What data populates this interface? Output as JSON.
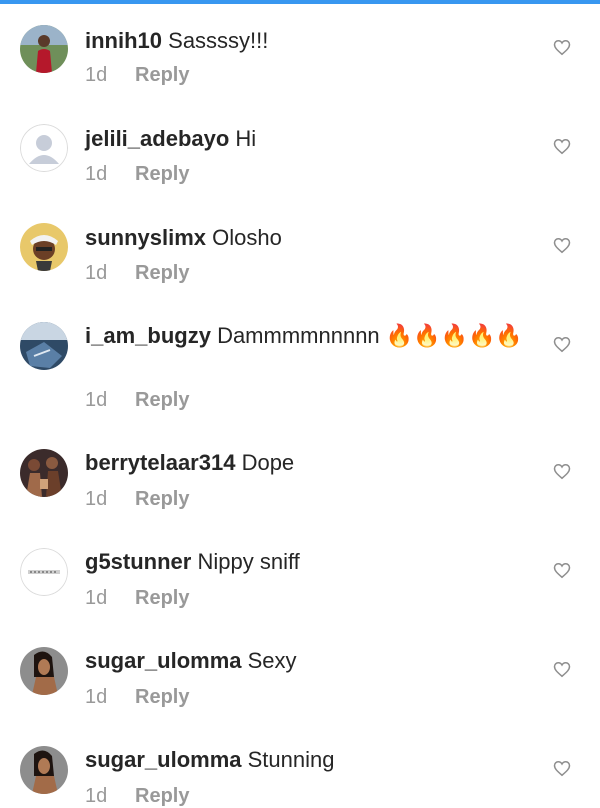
{
  "comments": [
    {
      "username": "innih10",
      "text": "Sassssy!!!",
      "time": "1d",
      "reply": "Reply",
      "avatar": "photo-person-red"
    },
    {
      "username": "jelili_adebayo",
      "text": "Hi",
      "time": "1d",
      "reply": "Reply",
      "avatar": "default-avatar"
    },
    {
      "username": "sunnyslimx",
      "text": "Olosho",
      "time": "1d",
      "reply": "Reply",
      "avatar": "photo-person-cap"
    },
    {
      "username": "i_am_bugzy",
      "text": "Dammmmnnnnn 🔥🔥🔥🔥🔥",
      "time": "1d",
      "reply": "Reply",
      "avatar": "photo-blue-graphic"
    },
    {
      "username": "berrytelaar314",
      "text": "Dope",
      "time": "1d",
      "reply": "Reply",
      "avatar": "photo-group"
    },
    {
      "username": "g5stunner",
      "text": "Nippy sniff",
      "time": "1d",
      "reply": "Reply",
      "avatar": "logo-text"
    },
    {
      "username": "sugar_ulomma",
      "text": "Sexy",
      "time": "1d",
      "reply": "Reply",
      "avatar": "photo-woman"
    },
    {
      "username": "sugar_ulomma",
      "text": "Stunning",
      "time": "1d",
      "reply": "Reply",
      "avatar": "photo-woman"
    }
  ],
  "colors": {
    "accent": "#3897f0",
    "text": "#262626",
    "muted": "#999999"
  },
  "icons": {
    "like": "heart-outline-icon"
  }
}
